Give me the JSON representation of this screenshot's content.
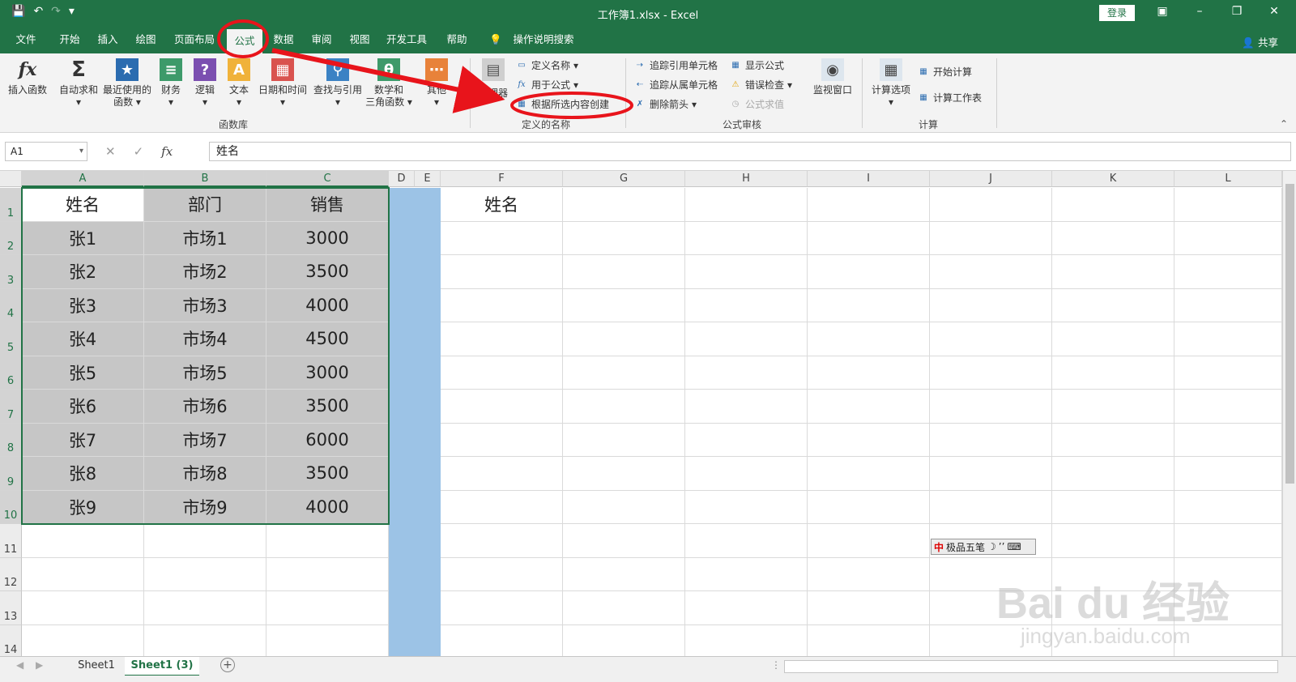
{
  "window": {
    "title": "工作簿1.xlsx  -  Excel",
    "login_label": "登录",
    "share_label": "共享"
  },
  "menu": {
    "tabs": [
      "文件",
      "开始",
      "插入",
      "绘图",
      "页面布局",
      "公式",
      "数据",
      "审阅",
      "视图",
      "开发工具",
      "帮助"
    ],
    "active_tab": "公式",
    "search_label": "操作说明搜索"
  },
  "ribbon": {
    "function_library": {
      "label": "函数库",
      "insert_function": "插入函数",
      "autosum": "自动求和",
      "recent_line1": "最近使用的",
      "recent_line2": "函数",
      "financial": "财务",
      "logical": "逻辑",
      "text": "文本",
      "datetime": "日期和时间",
      "lookup": "查找与引用",
      "math_line1": "数学和",
      "math_line2": "三角函数",
      "other": "其他"
    },
    "defined_names": {
      "label": "定义的名称",
      "name_manager": "管理器",
      "define_name": "定义名称",
      "use_in_formula": "用于公式",
      "create_from_selection": "根据所选内容创建"
    },
    "formula_auditing": {
      "label": "公式审核",
      "trace_precedents": "追踪引用单元格",
      "trace_dependents": "追踪从属单元格",
      "remove_arrows": "删除箭头",
      "show_formulas": "显示公式",
      "error_checking": "错误检查",
      "evaluate_formula": "公式求值",
      "watch_window": "监视窗口"
    },
    "calculation": {
      "label": "计算",
      "options": "计算选项",
      "calc_now": "开始计算",
      "calc_sheet": "计算工作表"
    }
  },
  "formula_bar": {
    "name_box": "A1",
    "content": "姓名"
  },
  "grid": {
    "columns": [
      "A",
      "B",
      "C",
      "D",
      "E",
      "F",
      "G",
      "H",
      "I",
      "J",
      "K",
      "L"
    ],
    "rows": [
      "1",
      "2",
      "3",
      "4",
      "5",
      "6",
      "7",
      "8",
      "9",
      "10",
      "11",
      "12",
      "13",
      "14"
    ],
    "data": [
      [
        "姓名",
        "部门",
        "销售"
      ],
      [
        "张1",
        "市场1",
        "3000"
      ],
      [
        "张2",
        "市场2",
        "3500"
      ],
      [
        "张3",
        "市场3",
        "4000"
      ],
      [
        "张4",
        "市场4",
        "4500"
      ],
      [
        "张5",
        "市场5",
        "3000"
      ],
      [
        "张6",
        "市场6",
        "3500"
      ],
      [
        "张7",
        "市场7",
        "6000"
      ],
      [
        "张8",
        "市场8",
        "3500"
      ],
      [
        "张9",
        "市场9",
        "4000"
      ]
    ],
    "f1": "姓名"
  },
  "sheets": [
    "Sheet1",
    "Sheet1 (3)"
  ],
  "active_sheet": "Sheet1 (3)",
  "ime": {
    "label": "极品五笔"
  },
  "watermark": {
    "logo": "Bai du 经验",
    "url": "jingyan.baidu.com"
  },
  "colors": {
    "excel_green": "#217346",
    "annotation_red": "#e8141b",
    "selection_gray": "#c6c6c6",
    "column_blue": "#9cc3e6"
  }
}
